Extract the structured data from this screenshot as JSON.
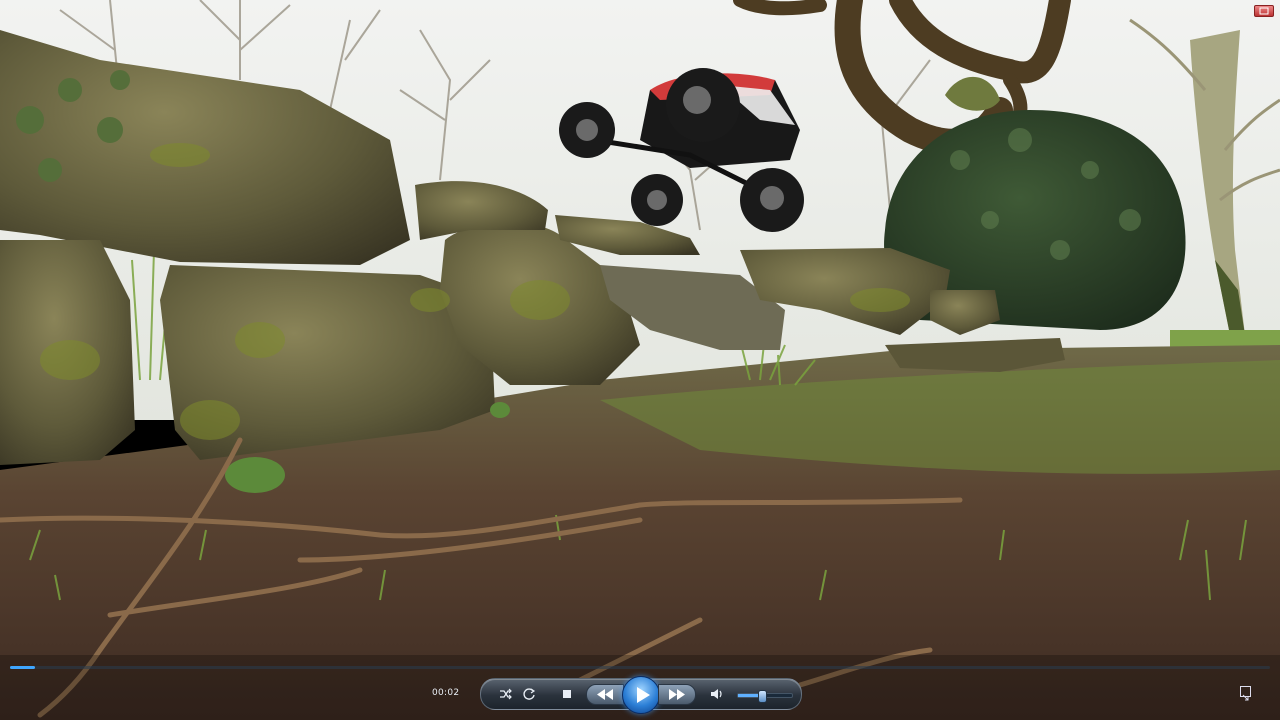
{
  "player": {
    "elapsed_time": "00:02",
    "progress": 0.02,
    "volume": 0.45,
    "icons": {
      "shuffle": "shuffle-icon",
      "repeat": "repeat-icon",
      "stop": "stop-icon",
      "previous": "previous-icon",
      "play": "play-icon",
      "next": "next-icon",
      "mute": "speaker-icon",
      "fullscreen": "fullscreen-icon",
      "restore": "restore-icon"
    },
    "colors": {
      "accent": "#3fa6ff",
      "play_button": "#2c7fd6",
      "bar_bg": "#2a323c"
    }
  }
}
